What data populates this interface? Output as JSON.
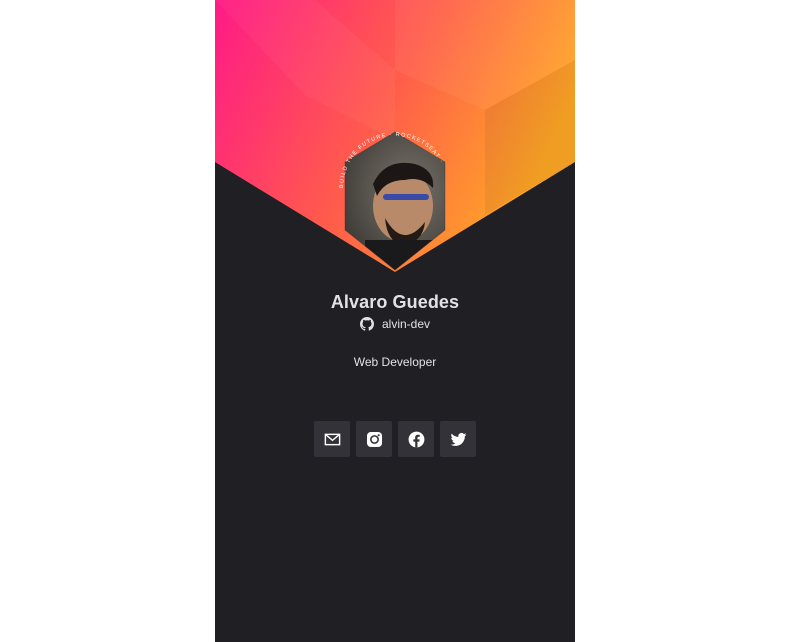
{
  "profile": {
    "name": "Alvaro Guedes",
    "github_user": "alvin-dev",
    "bio": "Web Developer",
    "badge_text": "BUILD THE FUTURE · ROCKETSEAT ·"
  },
  "icons": {
    "github": "github-icon",
    "email": "email-icon",
    "instagram": "instagram-icon",
    "facebook": "facebook-icon",
    "twitter": "twitter-icon"
  },
  "colors": {
    "card_background": "#202024",
    "gradient_start": "#ff1a86",
    "gradient_end": "#ffa726",
    "text": "#e1e1e6",
    "social_button": "#323238"
  }
}
